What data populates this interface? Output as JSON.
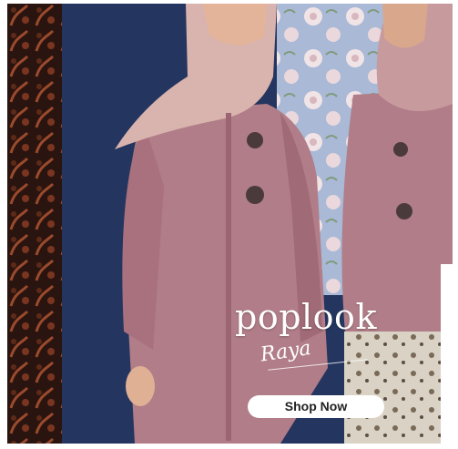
{
  "banner": {
    "brand_name": "poplook",
    "sub_brand": "Raya",
    "cta_label": "Shop Now"
  },
  "colors": {
    "background_navy": "#24355f",
    "dress_rose": "#b07d88",
    "hijab_blush": "#d9b3ad",
    "batik_dark": "#2a1410",
    "floral_blue": "#a9b9d6",
    "button_white": "#ffffff"
  }
}
